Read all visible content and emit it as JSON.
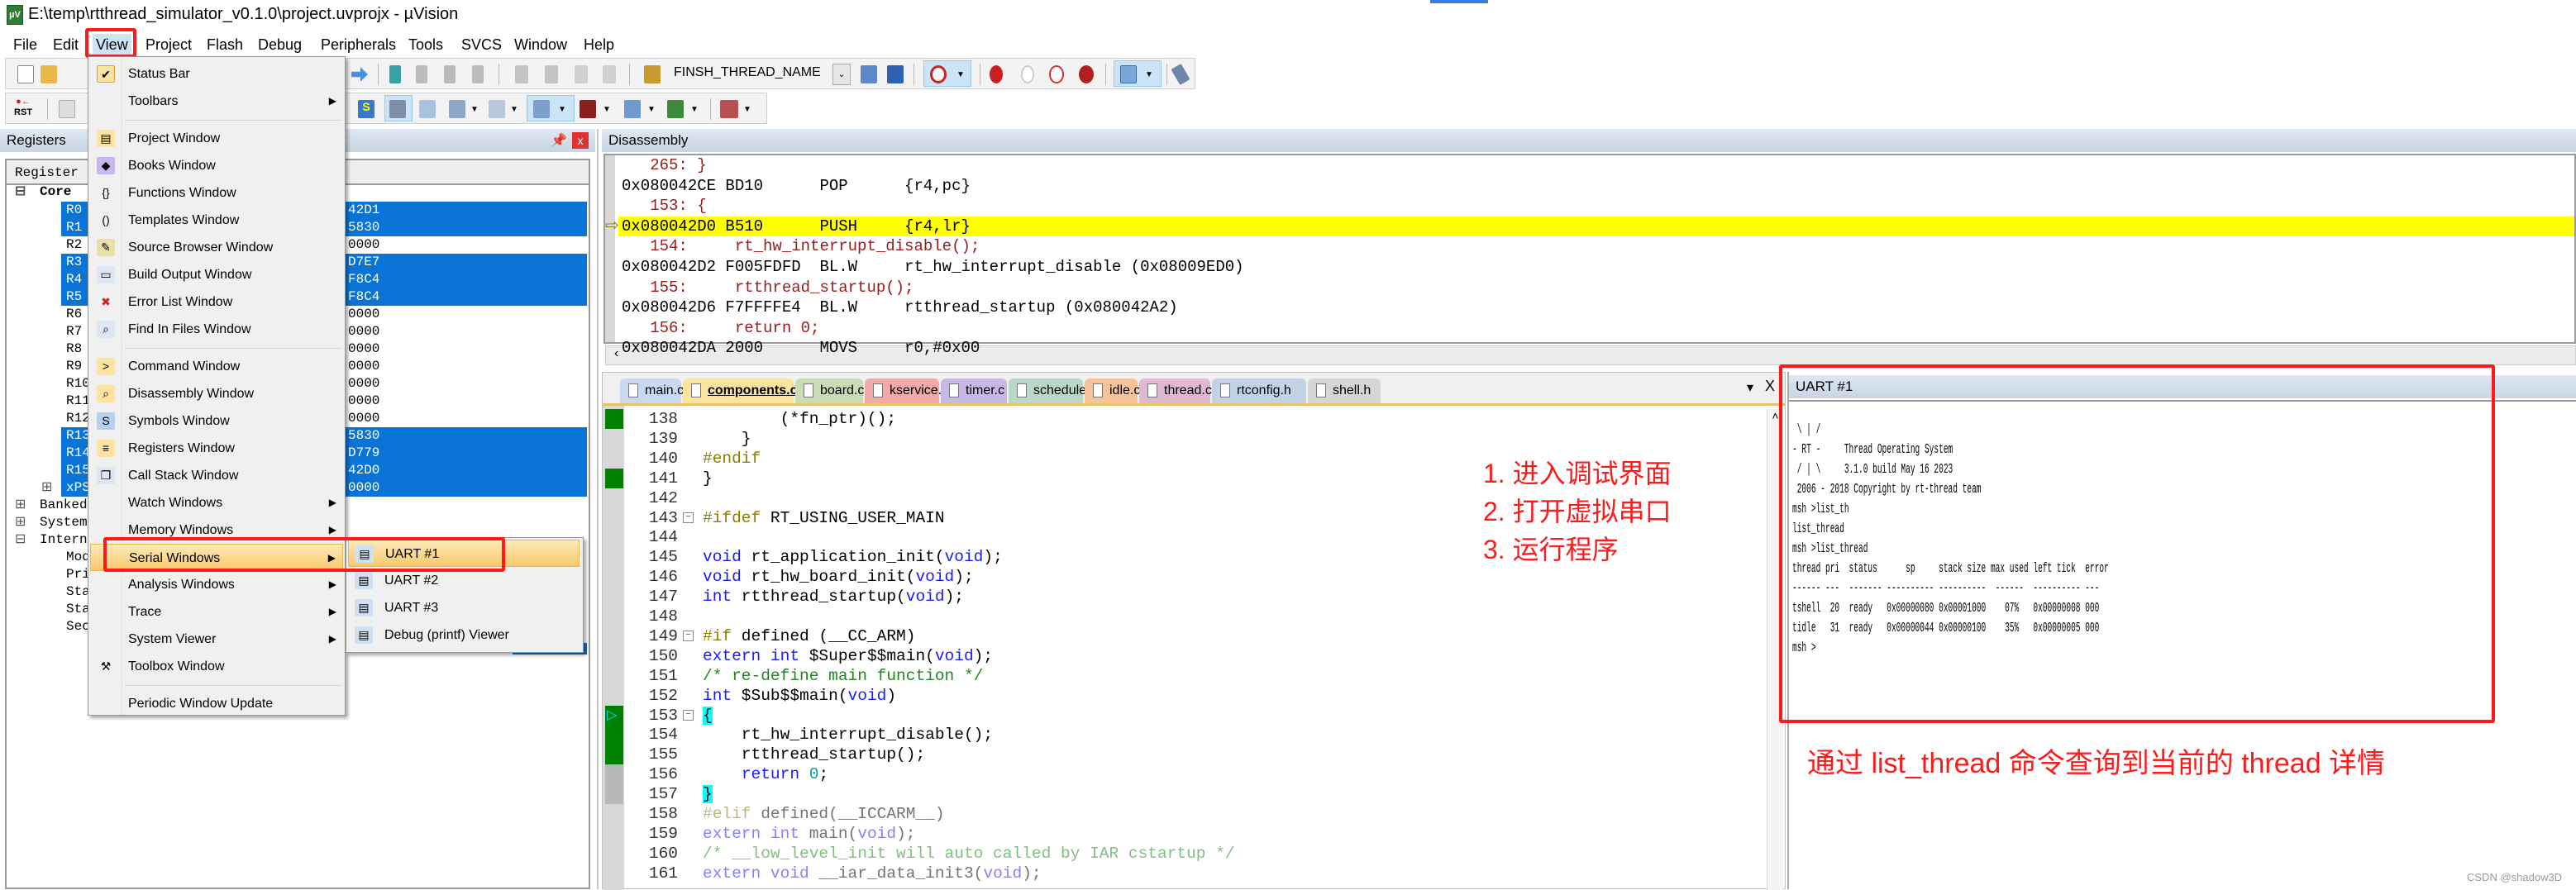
{
  "window": {
    "title": "E:\\temp\\rtthread_simulator_v0.1.0\\project.uvprojx - µVision"
  },
  "menubar": [
    "File",
    "Edit",
    "View",
    "Project",
    "Flash",
    "Debug",
    "Peripherals",
    "Tools",
    "SVCS",
    "Window",
    "Help"
  ],
  "toolbar": {
    "target_combo": "FINSH_THREAD_NAME",
    "reset_label": "RST"
  },
  "registers": {
    "title": "Registers",
    "column_header": "Register",
    "groups": {
      "core": "Core",
      "banked": "Banked",
      "system": "System",
      "internal": "Internal"
    },
    "rows": [
      {
        "name": "R0",
        "value": "42D1",
        "selected": true
      },
      {
        "name": "R1",
        "value": "5830",
        "selected": true
      },
      {
        "name": "R2",
        "value": "0000",
        "selected": false
      },
      {
        "name": "R3",
        "value": "D7E7",
        "selected": true
      },
      {
        "name": "R4",
        "value": "F8C4",
        "selected": true
      },
      {
        "name": "R5",
        "value": "F8C4",
        "selected": true
      },
      {
        "name": "R6",
        "value": "0000",
        "selected": false
      },
      {
        "name": "R7",
        "value": "0000",
        "selected": false
      },
      {
        "name": "R8",
        "value": "0000",
        "selected": false
      },
      {
        "name": "R9",
        "value": "0000",
        "selected": false
      },
      {
        "name": "R10",
        "value": "0000",
        "selected": false
      },
      {
        "name": "R11",
        "value": "0000",
        "selected": false
      },
      {
        "name": "R12",
        "value": "0000",
        "selected": false
      },
      {
        "name": "R13",
        "value": "5830",
        "selected": true
      },
      {
        "name": "R14",
        "value": "D779",
        "selected": true
      },
      {
        "name": "R15",
        "value": "42D0",
        "selected": true
      },
      {
        "name": "xPSR",
        "value": "0000",
        "selected": true
      }
    ],
    "internal_children": [
      "Mod",
      "Pri",
      "Sta",
      "Sta",
      "Sec"
    ]
  },
  "view_menu": {
    "items": [
      {
        "label": "Status Bar",
        "checked": true
      },
      {
        "label": "Toolbars",
        "submenu": true
      },
      {
        "label": "Project Window"
      },
      {
        "label": "Books Window"
      },
      {
        "label": "Functions Window"
      },
      {
        "label": "Templates Window"
      },
      {
        "label": "Source Browser Window"
      },
      {
        "label": "Build Output Window"
      },
      {
        "label": "Error List Window"
      },
      {
        "label": "Find In Files Window"
      },
      {
        "label": "Command Window"
      },
      {
        "label": "Disassembly Window"
      },
      {
        "label": "Symbols Window"
      },
      {
        "label": "Registers Window"
      },
      {
        "label": "Call Stack Window"
      },
      {
        "label": "Watch Windows",
        "submenu": true
      },
      {
        "label": "Memory Windows",
        "submenu": true
      },
      {
        "label": "Serial Windows",
        "submenu": true,
        "highlighted": true
      },
      {
        "label": "Analysis Windows",
        "submenu": true
      },
      {
        "label": "Trace",
        "submenu": true
      },
      {
        "label": "System Viewer",
        "submenu": true
      },
      {
        "label": "Toolbox Window"
      },
      {
        "label": "Periodic Window Update"
      }
    ],
    "serial_submenu": [
      {
        "label": "UART #1",
        "highlighted": true
      },
      {
        "label": "UART #2"
      },
      {
        "label": "UART #3"
      },
      {
        "label": "Debug (printf) Viewer"
      }
    ]
  },
  "disassembly": {
    "title": "Disassembly",
    "lines": [
      {
        "text": "   265: }",
        "src": true
      },
      {
        "text": "0x080042CE BD10      POP      {r4,pc}"
      },
      {
        "text": "   153: {",
        "src": true
      },
      {
        "text": "0x080042D0 B510      PUSH     {r4,lr}",
        "current": true
      },
      {
        "text": "   154:     rt_hw_interrupt_disable();",
        "src": true
      },
      {
        "text": "0x080042D2 F005FDFD  BL.W     rt_hw_interrupt_disable (0x08009ED0)"
      },
      {
        "text": "   155:     rtthread_startup();",
        "src": true
      },
      {
        "text": "0x080042D6 F7FFFFE4  BL.W     rtthread_startup (0x080042A2)"
      },
      {
        "text": "   156:     return 0;",
        "src": true
      },
      {
        "text": "0x080042DA 2000      MOVS     r0,#0x00"
      }
    ]
  },
  "editor": {
    "tabs": [
      {
        "label": "main.c",
        "color": "#c9d9f2"
      },
      {
        "label": "components.c",
        "color": "#fbe3a0",
        "active": true
      },
      {
        "label": "board.c",
        "color": "#c9dcb5"
      },
      {
        "label": "kservice.c",
        "color": "#f2a9a9"
      },
      {
        "label": "timer.c",
        "color": "#c8b8e8"
      },
      {
        "label": "scheduler.c",
        "color": "#b9d8c8"
      },
      {
        "label": "idle.c",
        "color": "#f7c49a"
      },
      {
        "label": "thread.c",
        "color": "#e0b8d0"
      },
      {
        "label": "rtconfig.h",
        "color": "#c3d3e6"
      },
      {
        "label": "shell.h",
        "color": "#d6d6d6"
      }
    ],
    "lines": [
      {
        "n": "138",
        "seg": [
          [
            "        (*fn_ptr)();",
            ""
          ]
        ],
        "gutter": "green"
      },
      {
        "n": "139",
        "seg": [
          [
            "    }",
            ""
          ]
        ]
      },
      {
        "n": "140",
        "seg": [
          [
            "#endif",
            "pp"
          ]
        ]
      },
      {
        "n": "141",
        "seg": [
          [
            "}",
            ""
          ]
        ],
        "gutter": "green"
      },
      {
        "n": "142",
        "seg": []
      },
      {
        "n": "143",
        "seg": [
          [
            "#ifdef",
            "pp"
          ],
          [
            " RT_USING_USER_MAIN",
            ""
          ]
        ],
        "fold": true
      },
      {
        "n": "144",
        "seg": []
      },
      {
        "n": "145",
        "seg": [
          [
            "void",
            "kw"
          ],
          [
            " rt_application_init(",
            ""
          ],
          [
            "void",
            "kw"
          ],
          [
            ");",
            ""
          ]
        ]
      },
      {
        "n": "146",
        "seg": [
          [
            "void",
            "kw"
          ],
          [
            " rt_hw_board_init(",
            ""
          ],
          [
            "void",
            "kw"
          ],
          [
            ");",
            ""
          ]
        ]
      },
      {
        "n": "147",
        "seg": [
          [
            "int",
            "kw"
          ],
          [
            " rtthread_startup(",
            ""
          ],
          [
            "void",
            "kw"
          ],
          [
            ");",
            ""
          ]
        ]
      },
      {
        "n": "148",
        "seg": []
      },
      {
        "n": "149",
        "seg": [
          [
            "#if",
            "pp"
          ],
          [
            " defined (__CC_ARM)",
            ""
          ]
        ],
        "fold": true
      },
      {
        "n": "150",
        "seg": [
          [
            "extern int",
            "kw"
          ],
          [
            " $Super$$main(",
            ""
          ],
          [
            "void",
            "kw"
          ],
          [
            ");",
            ""
          ]
        ]
      },
      {
        "n": "151",
        "seg": [
          [
            "/* re-define main function */",
            "cm"
          ]
        ]
      },
      {
        "n": "152",
        "seg": [
          [
            "int",
            "kw"
          ],
          [
            " $Sub$$main(",
            ""
          ],
          [
            "void",
            "kw"
          ],
          [
            ")",
            ""
          ]
        ]
      },
      {
        "n": "153",
        "seg": [
          [
            "{",
            "brace"
          ]
        ],
        "fold": true,
        "gutter": "green",
        "current": true
      },
      {
        "n": "154",
        "seg": [
          [
            "    rt_hw_interrupt_disable();",
            ""
          ]
        ],
        "gutter": "green"
      },
      {
        "n": "155",
        "seg": [
          [
            "    rtthread_startup();",
            ""
          ]
        ],
        "gutter": "green"
      },
      {
        "n": "156",
        "seg": [
          [
            "    ",
            ""
          ],
          [
            "return",
            "kw"
          ],
          [
            " ",
            ""
          ],
          [
            "0",
            "num"
          ],
          [
            ";",
            ""
          ]
        ],
        "gutter": "gray"
      },
      {
        "n": "157",
        "seg": [
          [
            "}",
            "brace"
          ]
        ],
        "gutter": "gray"
      },
      {
        "n": "158",
        "seg": [
          [
            "#elif",
            "pp"
          ],
          [
            " defined(__ICCARM__)",
            ""
          ]
        ],
        "inactive": true
      },
      {
        "n": "159",
        "seg": [
          [
            "extern int",
            "kw"
          ],
          [
            " main(",
            ""
          ],
          [
            "void",
            "kw"
          ],
          [
            ");",
            ""
          ]
        ],
        "inactive": true
      },
      {
        "n": "160",
        "seg": [
          [
            "/* __low_level_init will auto called by IAR cstartup */",
            "cm"
          ]
        ],
        "inactive": true
      },
      {
        "n": "161",
        "seg": [
          [
            "extern void",
            "kw"
          ],
          [
            " __iar_data_init3(",
            ""
          ],
          [
            "void",
            "kw"
          ],
          [
            ");",
            ""
          ]
        ],
        "inactive": true
      }
    ]
  },
  "annotation_steps": [
    "1. 进入调试界面",
    "2. 打开虚拟串口",
    "3. 运行程序"
  ],
  "uart": {
    "title": "UART #1",
    "lines": [
      " \\ | /",
      "- RT -     Thread Operating System",
      " / | \\     3.1.0 build May 16 2023",
      " 2006 - 2018 Copyright by rt-thread team",
      "msh >list_th",
      "list_thread",
      "msh >list_thread",
      "thread pri  status      sp     stack size max used left tick  error",
      "------ ---  ------- ---------- ----------  ------  ---------- ---",
      "tshell  20  ready   0x00000080 0x00001000    07%   0x00000008 000",
      "tidle   31  ready   0x00000044 0x00000100    35%   0x00000005 000",
      "msh >"
    ]
  },
  "annotation_caption": "通过 list_thread 命令查询到当前的 thread 详情",
  "watermark": "CSDN @shadow3D",
  "colors": {
    "highlight_red": "#ff1a1a",
    "selection_blue": "#0a74d6",
    "current_line_yellow": "#ffff00"
  }
}
